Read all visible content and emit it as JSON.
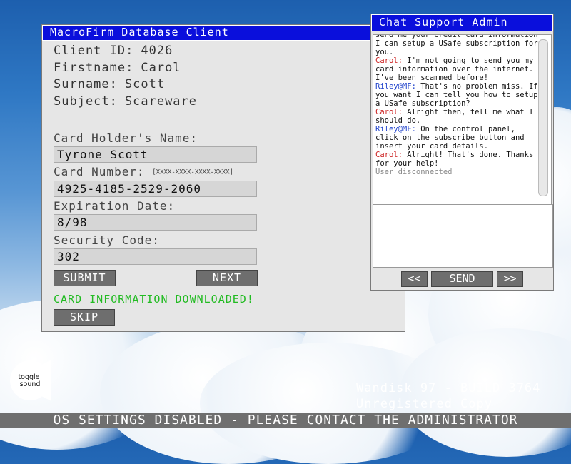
{
  "db_window": {
    "title": "MacroFirm Database Client",
    "client_id_label": "Client ID:",
    "client_id": "4026",
    "firstname_label": "Firstname:",
    "firstname": "Carol",
    "surname_label": "Surname:",
    "surname": "Scott",
    "subject_label": "Subject:",
    "subject": "Scareware",
    "card_holder_label": "Card Holder's Name:",
    "card_holder_value": "Tyrone Scott",
    "card_number_label": "Card Number:",
    "card_number_hint": "[XXXX-XXXX-XXXX-XXXX]",
    "card_number_value": "4925-4185-2529-2060",
    "expiration_label": "Expiration Date:",
    "expiration_value": "8/98",
    "security_label": "Security Code:",
    "security_value": "302",
    "submit_label": "SUBMIT",
    "next_label": "NEXT",
    "status_text": "CARD INFORMATION DOWNLOADED!",
    "skip_label": "SKIP"
  },
  "chat_window": {
    "title": "Chat Support Admin",
    "messages": {
      "m1": "send me your credit card information I can setup a USafe subscription for you.",
      "m2_who": "Carol:",
      "m2": " I'm not going to send you my card information over the internet. I've been scammed before!",
      "m3_who": "Riley@MF:",
      "m3": " That's no problem miss. If you want I can tell you how to setup a USafe subscription?",
      "m4_who": "Carol:",
      "m4": " Alright then, tell me what I should do.",
      "m5_who": "Riley@MF:",
      "m5": " On the control panel, click on the subscribe button and insert your card details.",
      "m6_who": "Carol:",
      "m6": " Alright! That's done. Thanks for your help!",
      "m7": "User disconnected"
    },
    "prev_label": "<<",
    "send_label": "SEND",
    "next_label": ">>"
  },
  "toggle_sound_label": "toggle\nsound",
  "build_line1": "Wandisk 97 - BUILD 3764",
  "build_line2": "Unregistered Copy",
  "footer_text": "OS SETTINGS DISABLED - PLEASE CONTACT THE ADMINISTRATOR",
  "colors": {
    "titlebar": "#0a0fdc",
    "status_green": "#22bb22",
    "button_gray": "#6e6e6e",
    "carol_red": "#cc2222",
    "riley_blue": "#2244cc"
  }
}
